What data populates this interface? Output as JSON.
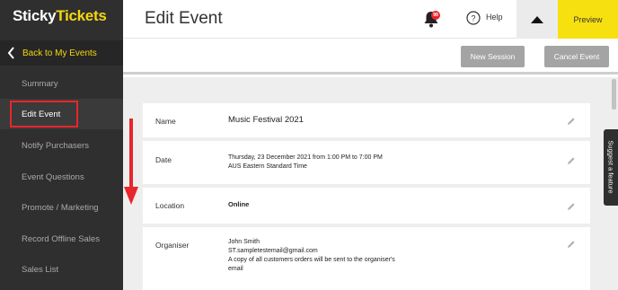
{
  "brand": {
    "part1": "Sticky",
    "part2": "Tickets"
  },
  "sidebar": {
    "back_label": "Back to My Events",
    "items": [
      {
        "label": "Summary"
      },
      {
        "label": "Edit Event",
        "active": true
      },
      {
        "label": "Notify Purchasers"
      },
      {
        "label": "Event Questions"
      },
      {
        "label": "Promote / Marketing"
      },
      {
        "label": "Record Offline Sales"
      },
      {
        "label": "Sales List"
      }
    ]
  },
  "header": {
    "title": "Edit Event",
    "notification_count": "99",
    "help_label": "Help",
    "preview_label": "Preview"
  },
  "actions": {
    "new_session_label": "New Session",
    "cancel_event_label": "Cancel Event"
  },
  "fields": {
    "name": {
      "label": "Name",
      "value": "Music Festival 2021"
    },
    "date": {
      "label": "Date",
      "line1": "Thursday, 23 December 2021 from 1:00 PM to 7:00 PM",
      "line2": "AUS Eastern Standard Time"
    },
    "location": {
      "label": "Location",
      "value": "Online"
    },
    "organiser": {
      "label": "Organiser",
      "line1": "John Smith",
      "line2": "ST.sampletestemail@gmail.com",
      "line3": "A copy of all customers orders will be sent to the organiser's",
      "line4": "email"
    }
  },
  "suggest_feature_label": "Suggest a feature",
  "colors": {
    "brand_yellow": "#f5d60e",
    "sidebar_bg": "#2f2f2f",
    "preview_bg": "#f7e010",
    "annotation_red": "#e8262c",
    "button_grey": "#a4a4a4"
  },
  "icons": [
    "chevron-left-icon",
    "bell-icon",
    "help-circle-icon",
    "caret-up-icon",
    "pencil-icon"
  ]
}
